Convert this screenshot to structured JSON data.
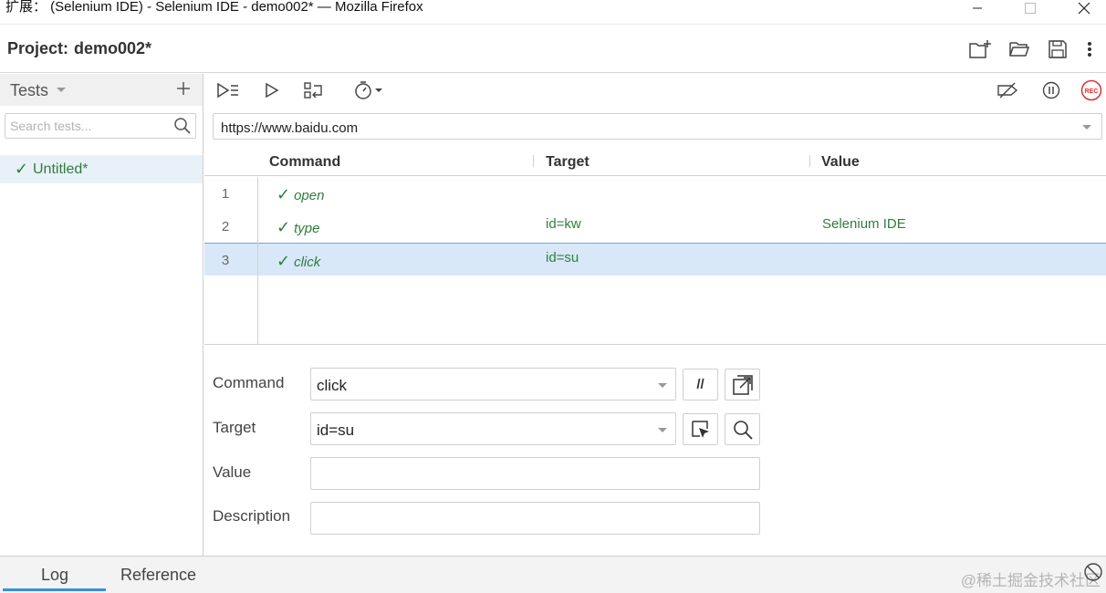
{
  "window": {
    "title": "扩展： (Selenium IDE) - Selenium IDE - demo002* — Mozilla Firefox"
  },
  "project": {
    "label": "Project:",
    "name": "demo002*"
  },
  "sidebar": {
    "title": "Tests",
    "search_placeholder": "Search tests...",
    "tests": [
      {
        "check": "✓",
        "name": "Untitled*"
      }
    ]
  },
  "url": {
    "value": "https://www.baidu.com"
  },
  "table": {
    "headers": {
      "command": "Command",
      "target": "Target",
      "value": "Value"
    },
    "rows": [
      {
        "num": "1",
        "check": "✓",
        "command": "open",
        "target": "",
        "value": ""
      },
      {
        "num": "2",
        "check": "✓",
        "command": "type",
        "target": "id=kw",
        "value": "Selenium IDE"
      },
      {
        "num": "3",
        "check": "✓",
        "command": "click",
        "target": "id=su",
        "value": ""
      }
    ],
    "selected_row": 3
  },
  "editor": {
    "command_label": "Command",
    "command_value": "click",
    "comment_button": "//",
    "target_label": "Target",
    "target_value": "id=su",
    "value_label": "Value",
    "value_value": "",
    "description_label": "Description",
    "description_value": ""
  },
  "bottom": {
    "tabs": [
      "Log",
      "Reference"
    ],
    "active_tab": "Log",
    "watermark": "@稀土掘金技术社区"
  },
  "colors": {
    "pass_green": "#2f7d3c",
    "selection": "#d8e8f8",
    "accent_blue": "#3b8fd8",
    "record_red": "#d9302c"
  }
}
